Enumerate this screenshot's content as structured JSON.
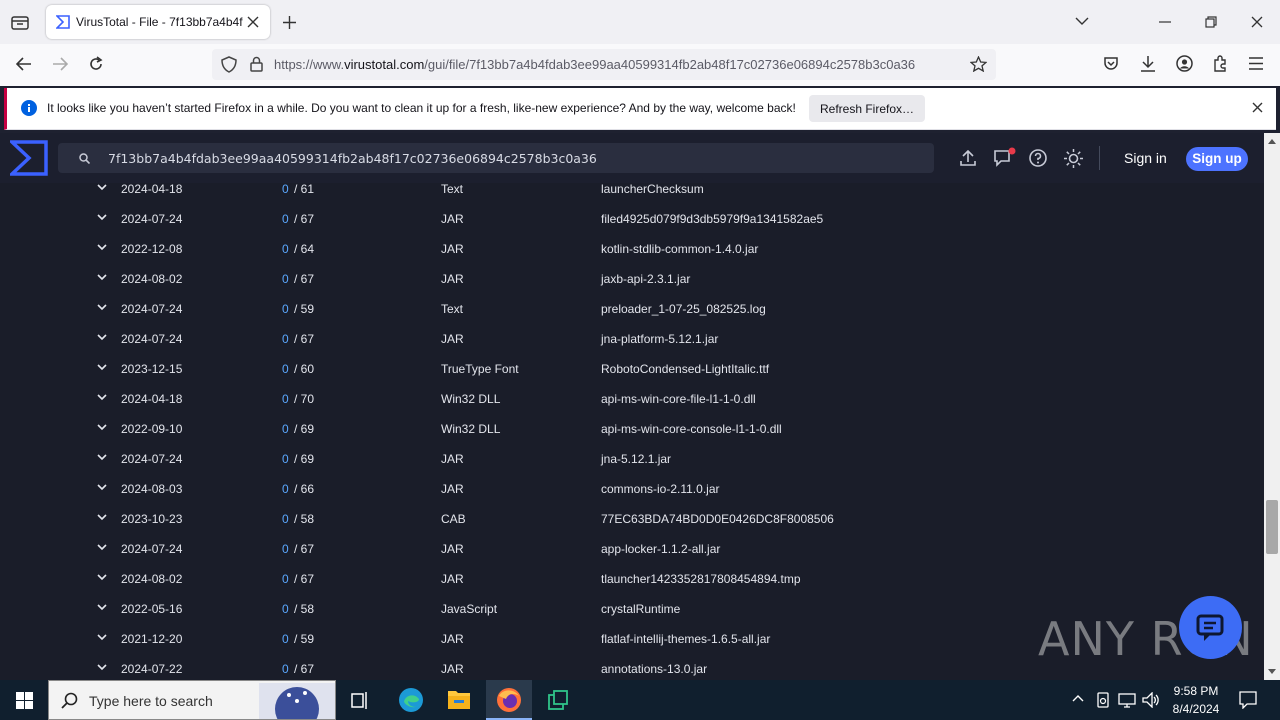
{
  "browser": {
    "tab_title": "VirusTotal - File - 7f13bb7a4b4f",
    "url_prefix": "https://www.",
    "url_domain": "virustotal.com",
    "url_path": "/gui/file/7f13bb7a4b4fdab3ee99aa40599314fb2ab48f17c02736e06894c2578b3c0a36"
  },
  "notification": {
    "text": "It looks like you haven’t started Firefox in a while. Do you want to clean it up for a fresh, like-new experience? And by the way, welcome back!",
    "button": "Refresh Firefox…"
  },
  "vt": {
    "search_value": "7f13bb7a4b4fdab3ee99aa40599314fb2ab48f17c02736e06894c2578b3c0a36",
    "signin": "Sign in",
    "signup": "Sign up"
  },
  "rows": [
    {
      "date": "2024-04-18",
      "det": "0",
      "tot": "/ 61",
      "type": "Text",
      "name": "launcherChecksum"
    },
    {
      "date": "2024-07-24",
      "det": "0",
      "tot": "/ 67",
      "type": "JAR",
      "name": "filed4925d079f9d3db5979f9a1341582ae5"
    },
    {
      "date": "2022-12-08",
      "det": "0",
      "tot": "/ 64",
      "type": "JAR",
      "name": "kotlin-stdlib-common-1.4.0.jar"
    },
    {
      "date": "2024-08-02",
      "det": "0",
      "tot": "/ 67",
      "type": "JAR",
      "name": "jaxb-api-2.3.1.jar"
    },
    {
      "date": "2024-07-24",
      "det": "0",
      "tot": "/ 59",
      "type": "Text",
      "name": "preloader_1-07-25_082525.log"
    },
    {
      "date": "2024-07-24",
      "det": "0",
      "tot": "/ 67",
      "type": "JAR",
      "name": "jna-platform-5.12.1.jar"
    },
    {
      "date": "2023-12-15",
      "det": "0",
      "tot": "/ 60",
      "type": "TrueType Font",
      "name": "RobotoCondensed-LightItalic.ttf"
    },
    {
      "date": "2024-04-18",
      "det": "0",
      "tot": "/ 70",
      "type": "Win32 DLL",
      "name": "api-ms-win-core-file-l1-1-0.dll"
    },
    {
      "date": "2022-09-10",
      "det": "0",
      "tot": "/ 69",
      "type": "Win32 DLL",
      "name": "api-ms-win-core-console-l1-1-0.dll"
    },
    {
      "date": "2024-07-24",
      "det": "0",
      "tot": "/ 69",
      "type": "JAR",
      "name": "jna-5.12.1.jar"
    },
    {
      "date": "2024-08-03",
      "det": "0",
      "tot": "/ 66",
      "type": "JAR",
      "name": "commons-io-2.11.0.jar"
    },
    {
      "date": "2023-10-23",
      "det": "0",
      "tot": "/ 58",
      "type": "CAB",
      "name": "77EC63BDA74BD0D0E0426DC8F8008506"
    },
    {
      "date": "2024-07-24",
      "det": "0",
      "tot": "/ 67",
      "type": "JAR",
      "name": "app-locker-1.1.2-all.jar"
    },
    {
      "date": "2024-08-02",
      "det": "0",
      "tot": "/ 67",
      "type": "JAR",
      "name": "tlauncher1423352817808454894.tmp"
    },
    {
      "date": "2022-05-16",
      "det": "0",
      "tot": "/ 58",
      "type": "JavaScript",
      "name": "crystalRuntime"
    },
    {
      "date": "2021-12-20",
      "det": "0",
      "tot": "/ 59",
      "type": "JAR",
      "name": "flatlaf-intellij-themes-1.6.5-all.jar"
    },
    {
      "date": "2024-07-22",
      "det": "0",
      "tot": "/ 67",
      "type": "JAR",
      "name": "annotations-13.0.jar"
    }
  ],
  "taskbar": {
    "search_placeholder": "Type here to search",
    "time": "9:58 PM",
    "date": "8/4/2024"
  },
  "watermark": "ANY RUN"
}
